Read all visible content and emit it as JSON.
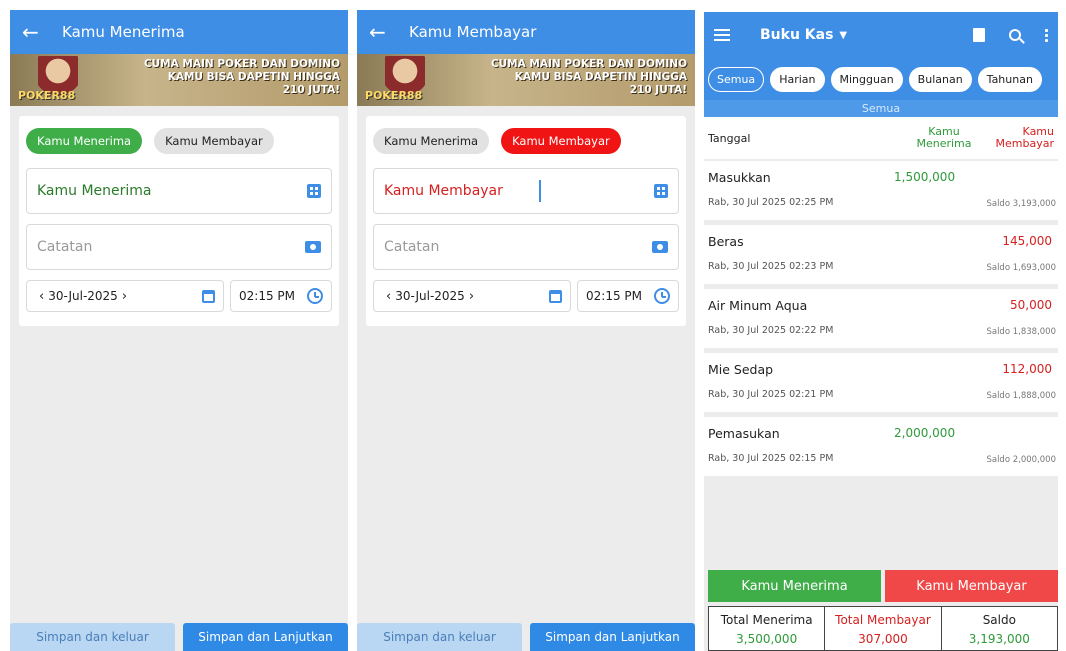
{
  "panel1": {
    "title": "Kamu Menerima",
    "banner": {
      "line1": "CUMA MAIN POKER DAN DOMINO",
      "line2": "KAMU BISA DAPETIN HINGGA",
      "line3": "210 JUTA!",
      "logo": "POKER88"
    },
    "toggle_receive": "Kamu Menerima",
    "toggle_pay": "Kamu Membayar",
    "amount_placeholder": "Kamu Menerima",
    "note_placeholder": "Catatan",
    "date": "30-Jul-2025",
    "time": "02:15 PM",
    "btn_save_exit": "Simpan dan keluar",
    "btn_save_continue": "Simpan dan Lanjutkan",
    "active_color": "#3fae49"
  },
  "panel2": {
    "title": "Kamu Membayar",
    "banner": {
      "line1": "CUMA MAIN POKER DAN DOMINO",
      "line2": "KAMU BISA DAPETIN HINGGA",
      "line3": "210 JUTA!",
      "logo": "POKER88"
    },
    "toggle_receive": "Kamu Menerima",
    "toggle_pay": "Kamu Membayar",
    "amount_placeholder": "Kamu Membayar",
    "note_placeholder": "Catatan",
    "date": "30-Jul-2025",
    "time": "02:15 PM",
    "btn_save_exit": "Simpan dan keluar",
    "btn_save_continue": "Simpan dan Lanjutkan",
    "active_color": "#f01414"
  },
  "panel3": {
    "title": "Buku Kas",
    "filters": [
      "Semua",
      "Harian",
      "Mingguan",
      "Bulanan",
      "Tahunan"
    ],
    "active_filter": "Semua",
    "section": "Semua",
    "columns": {
      "date": "Tanggal",
      "in_line1": "Kamu",
      "in_line2": "Menerima",
      "out_line1": "Kamu",
      "out_line2": "Membayar"
    },
    "rows": [
      {
        "name": "Masukkan",
        "date": "Rab, 30 Jul 2025 02:25 PM",
        "in": "1,500,000",
        "out": "",
        "saldo": "Saldo 3,193,000"
      },
      {
        "name": "Beras",
        "date": "Rab, 30 Jul 2025 02:23 PM",
        "in": "",
        "out": "145,000",
        "saldo": "Saldo 1,693,000"
      },
      {
        "name": "Air Minum Aqua",
        "date": "Rab, 30 Jul 2025 02:22 PM",
        "in": "",
        "out": "50,000",
        "saldo": "Saldo 1,838,000"
      },
      {
        "name": "Mie Sedap",
        "date": "Rab, 30 Jul 2025 02:21 PM",
        "in": "",
        "out": "112,000",
        "saldo": "Saldo 1,888,000"
      },
      {
        "name": "Pemasukan",
        "date": "Rab, 30 Jul 2025 02:15 PM",
        "in": "2,000,000",
        "out": "",
        "saldo": "Saldo 2,000,000"
      }
    ],
    "btn_receive": "Kamu Menerima",
    "btn_pay": "Kamu Membayar",
    "totals": {
      "receive_label": "Total Menerima",
      "receive_value": "3,500,000",
      "pay_label": "Total Membayar",
      "pay_value": "307,000",
      "saldo_label": "Saldo",
      "saldo_value": "3,193,000"
    }
  }
}
